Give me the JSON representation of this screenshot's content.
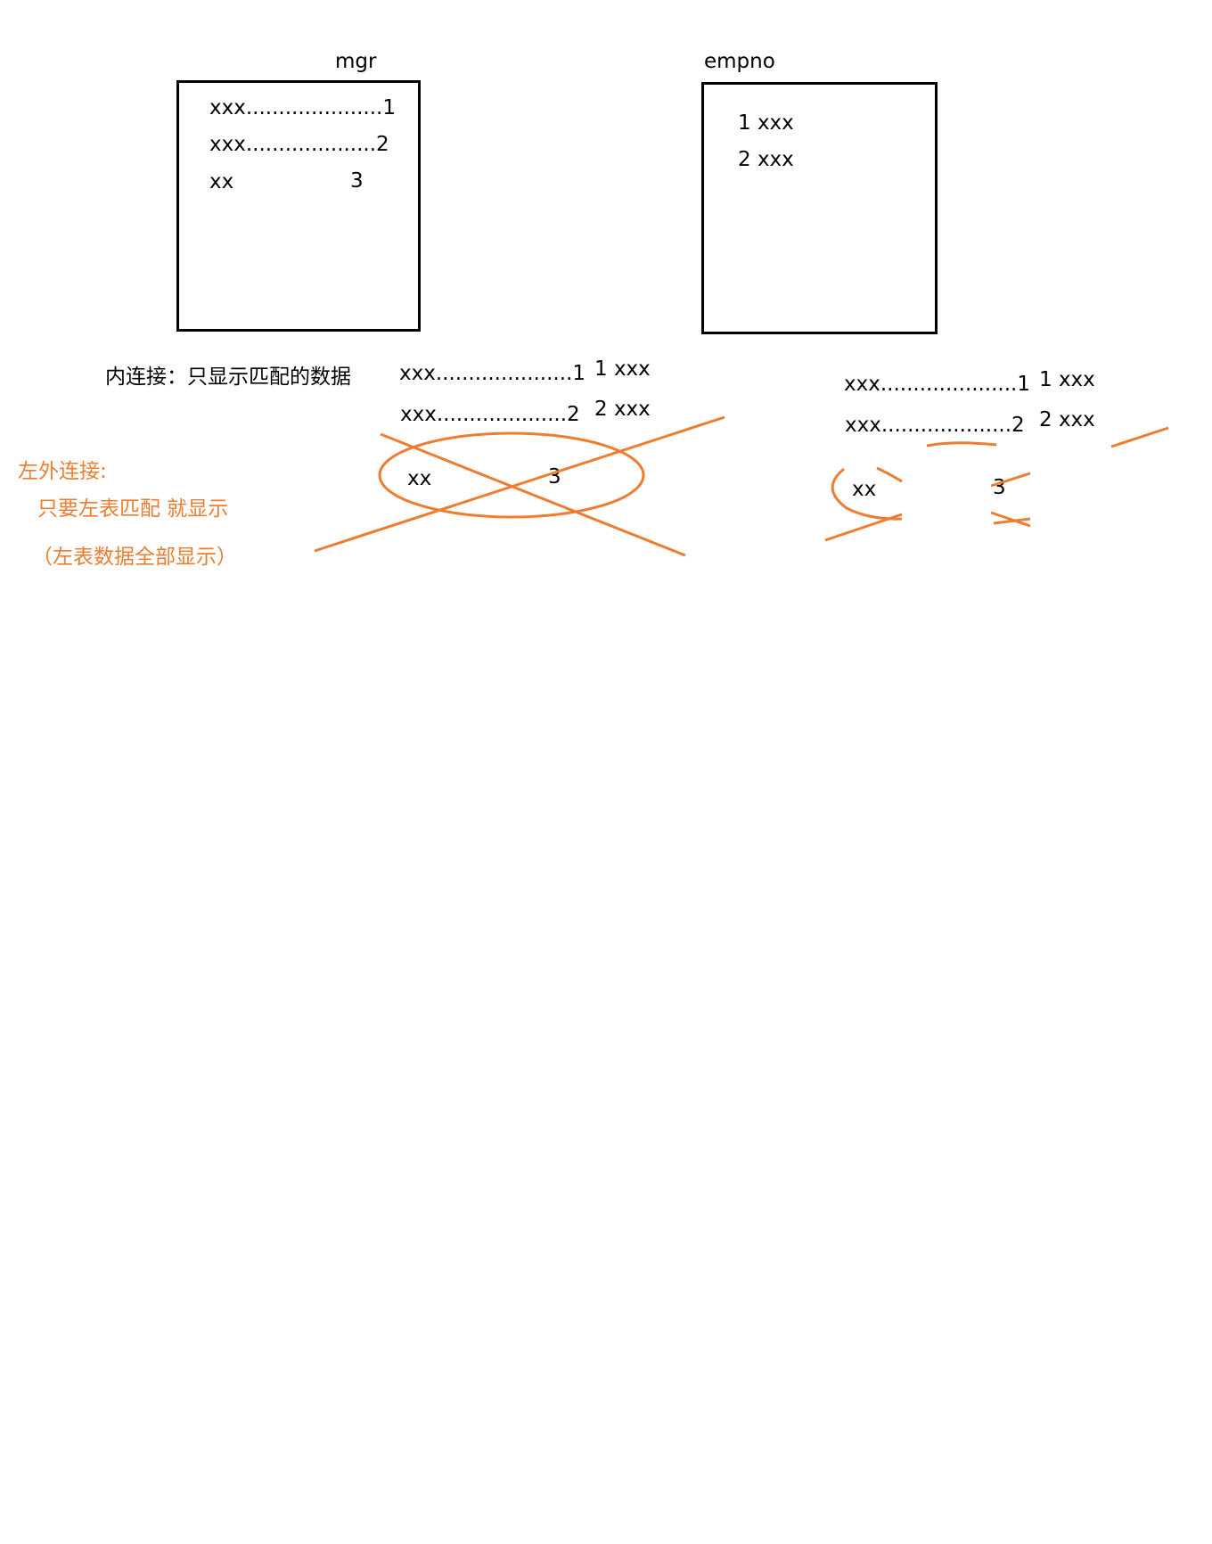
{
  "colors": {
    "ink": "#000000",
    "accent": "#ED7D31",
    "background": "#FFFFFF"
  },
  "left_table": {
    "title": "mgr",
    "rows": [
      "xxx.....................1",
      "xxx....................2",
      "xx",
      "3"
    ]
  },
  "right_table": {
    "title": "empno",
    "rows": [
      "1  xxx",
      "2  xxx"
    ]
  },
  "inner_join": {
    "caption": "内连接：只显示匹配的数据",
    "left_rows": [
      "xxx.....................1",
      "xxx....................2",
      "xx",
      "3"
    ],
    "right_rows": [
      "1  xxx",
      "2  xxx"
    ]
  },
  "left_outer_join": {
    "caption_title": "左外连接:",
    "caption_line1": "只要左表匹配 就显示",
    "caption_line2": "（左表数据全部显示）",
    "left_rows": [
      "xxx.....................1",
      "xxx....................2",
      "xx",
      "3"
    ],
    "right_rows": [
      "1  xxx",
      "2  xxx"
    ]
  }
}
